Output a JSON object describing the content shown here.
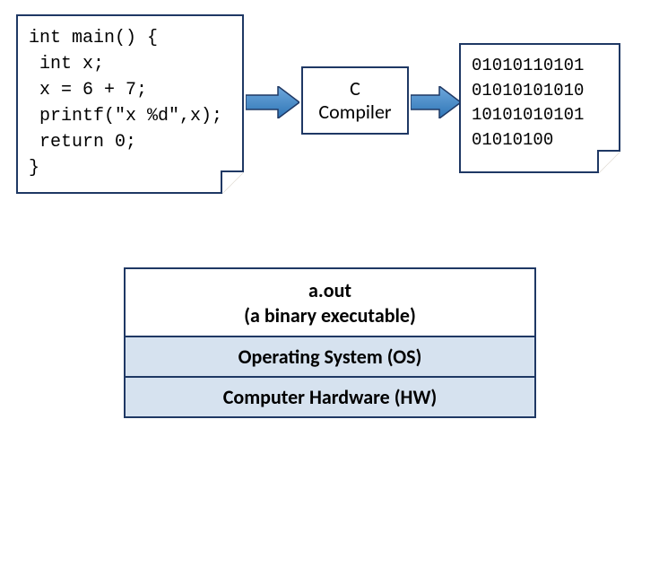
{
  "source_code": "int main() {\n int x;\n x = 6 + 7;\n printf(\"x %d\",x);\n return 0;\n}",
  "compiler_box": {
    "line1": "C",
    "line2": "Compiler"
  },
  "binary_output": "01010110101\n01010101010\n10101010101\n01010100",
  "stack": {
    "top_line1": "a.out",
    "top_line2": "(a binary executable)",
    "middle": "Operating System (OS)",
    "bottom": "Computer Hardware (HW)"
  },
  "caption": ""
}
